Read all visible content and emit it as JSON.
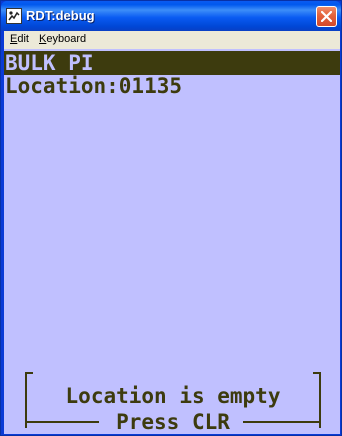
{
  "window": {
    "title": "RDT:debug",
    "icon": "app-icon",
    "close_icon": "close-icon"
  },
  "menu": {
    "items": [
      {
        "label": "Edit",
        "mnemonic": "E",
        "rest": "dit"
      },
      {
        "label": "Keyboard",
        "mnemonic": "K",
        "rest": "eyboard"
      }
    ]
  },
  "screen": {
    "header": "BULK PI",
    "location_line": "Location:01135",
    "message": {
      "line1": "Location is empty",
      "line2": "Press CLR"
    }
  },
  "colors": {
    "screen_bg": "#c0c0ff",
    "terminal_fg": "#3d3b0e",
    "titlebar": "#0a5bf2"
  }
}
